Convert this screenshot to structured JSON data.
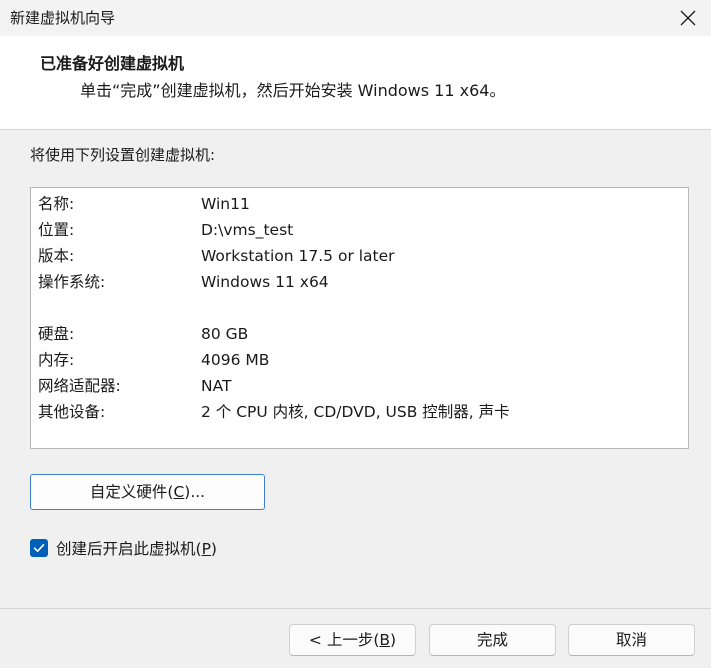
{
  "window": {
    "title": "新建虚拟机向导",
    "close_icon": "close-icon"
  },
  "header": {
    "title": "已准备好创建虚拟机",
    "subtitle": "单击“完成”创建虚拟机，然后开始安装 Windows 11 x64。"
  },
  "summary": {
    "label": "将使用下列设置创建虚拟机:",
    "rows": [
      {
        "key": "名称:",
        "value": "Win11"
      },
      {
        "key": "位置:",
        "value": "D:\\vms_test"
      },
      {
        "key": "版本:",
        "value": "Workstation 17.5 or later"
      },
      {
        "key": "操作系统:",
        "value": "Windows 11 x64"
      },
      {
        "key": "硬盘:",
        "value": "80 GB"
      },
      {
        "key": "内存:",
        "value": "4096 MB"
      },
      {
        "key": "网络适配器:",
        "value": "NAT"
      },
      {
        "key": "其他设备:",
        "value": "2 个 CPU 内核, CD/DVD, USB 控制器, 声卡"
      }
    ]
  },
  "customize_button": {
    "label_before": "自定义硬件(",
    "mnemonic": "C",
    "label_after": ")..."
  },
  "power_on_checkbox": {
    "checked": true,
    "label_before": "创建后开启此虚拟机(",
    "mnemonic": "P",
    "label_after": ")"
  },
  "footer": {
    "back_before": "< 上一步(",
    "back_mnemonic": "B",
    "back_after": ")",
    "finish": "完成",
    "cancel": "取消"
  },
  "colors": {
    "accent": "#005fb8",
    "focus_border": "#3c7fd1"
  }
}
